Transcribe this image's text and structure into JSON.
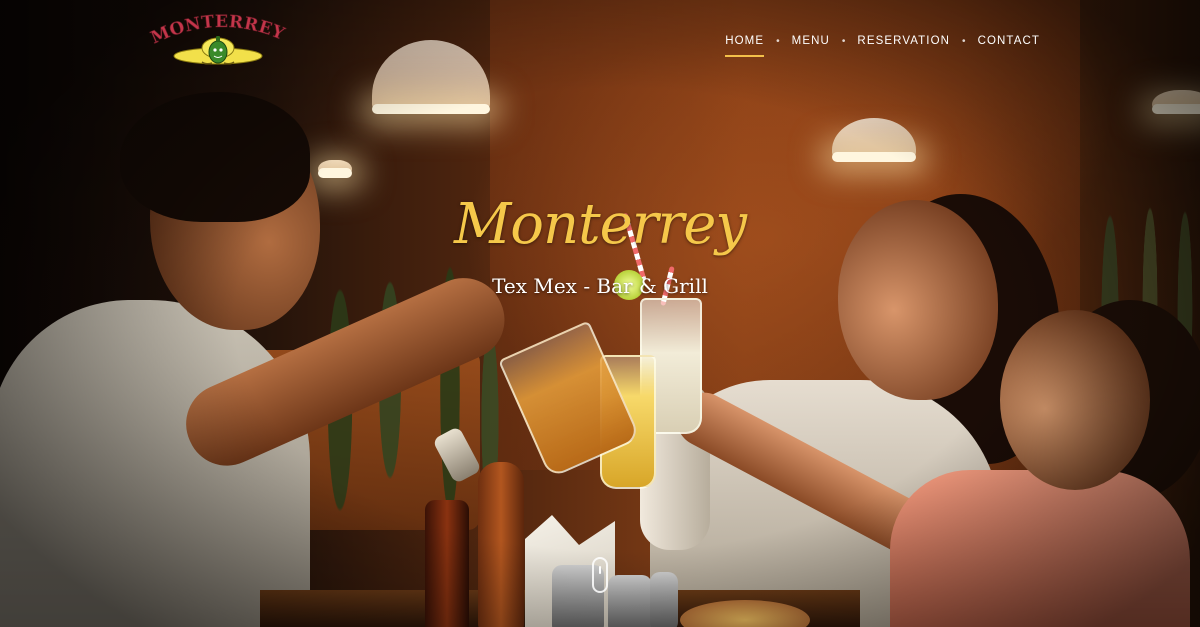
{
  "header": {
    "logo_text": "MONTERREY",
    "nav": [
      {
        "label": "HOME",
        "active": true
      },
      {
        "label": "MENU",
        "active": false
      },
      {
        "label": "RESERVATION",
        "active": false
      },
      {
        "label": "CONTACT",
        "active": false
      }
    ],
    "separator": "•"
  },
  "hero": {
    "title": "Monterrey",
    "subtitle": "Tex Mex - Bar & Grill"
  },
  "colors": {
    "accent": "#f3c04a",
    "title": "#f5c84a",
    "nav_text": "#ffffff"
  },
  "icons": {
    "logo": "sombrero-pepper-logo",
    "scroll": "mouse-scroll-icon"
  }
}
